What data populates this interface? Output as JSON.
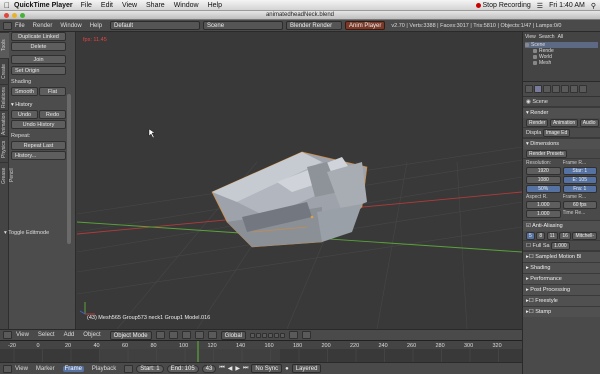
{
  "mac_menubar": {
    "app_name": "QuickTime Player",
    "menus": [
      "File",
      "Edit",
      "View",
      "Share",
      "Window",
      "Help"
    ],
    "recording_label": "Stop Recording",
    "clock": "Fri 1:40 AM"
  },
  "window": {
    "title": "animatedheadNeck.blend"
  },
  "info_header": {
    "menus": [
      "File",
      "Render",
      "Window",
      "Help"
    ],
    "screen_layout": "Default",
    "scene": "Scene",
    "render_engine": "Blender Render",
    "anim_player": "Anim Player",
    "stats": "v2.70 | Verts:3388 | Faces:3017 | Tris:5810 | Objects:1/47 | Lamps:0/0"
  },
  "tool_tabs": [
    "Tools",
    "Create",
    "Relations",
    "Animation",
    "Physics",
    "Grease Pencil"
  ],
  "tool_shelf": {
    "buttons_top": [
      "Duplicate Linked",
      "Delete",
      "Join",
      "Set Origin"
    ],
    "shading_label": "Shading",
    "shading_buttons": [
      "Smooth",
      "Flat"
    ],
    "history_label": "History",
    "history_row": [
      "Undo",
      "Redo"
    ],
    "undo_history": "Undo History",
    "repeat_label": "Repeat:",
    "repeat_last": "Repeat Last",
    "history_btn": "History...",
    "toggle_editmode": "Toggle Editmode"
  },
  "viewport": {
    "fps": "fps: 11.45",
    "object_info": "(43) Mesh565 Group573 neck1 Group1 Model.016"
  },
  "outliner": {
    "header": [
      "View",
      "Search",
      "All"
    ],
    "items": [
      "Scene",
      "Rende",
      "World",
      "Mesh"
    ]
  },
  "properties": {
    "breadcrumb": "Scene",
    "render_section": "Render",
    "render_buttons": [
      "Render",
      "Animation",
      "Audio"
    ],
    "display_label": "Displa",
    "display_value": "Image Ed",
    "dimensions_section": "Dimensions",
    "render_presets": "Render Presets",
    "resolution_label": "Resolution:",
    "frame_range_label": "Frame R...",
    "res_x": "1920",
    "res_y": "1080",
    "res_pct": "50%",
    "start": "Star: 1",
    "end": "E: 105",
    "frame_step": "Fra: 1",
    "aspect_label": "Aspect R.",
    "frame_rate_label": "Frame R...",
    "aspect_x": "1.000",
    "aspect_y": "1.000",
    "fps_value": "60 fps",
    "time_remap": "Time Re...",
    "antialiasing": "Anti-Aliasing",
    "aa_samples": [
      "5",
      "8",
      "11",
      "16"
    ],
    "aa_filter": "Mitchell-",
    "full_sample": "Full Sa",
    "aa_size": "1.000",
    "sections_collapsed": [
      "Sampled Motion Bl",
      "Shading",
      "Performance",
      "Post Processing",
      "Freestyle",
      "Stamp"
    ]
  },
  "view3d_header": {
    "menus": [
      "View",
      "Select",
      "Add",
      "Object"
    ],
    "mode": "Object Mode",
    "pivot": "Global"
  },
  "timeline": {
    "ticks": [
      "-20",
      "0",
      "20",
      "40",
      "60",
      "80",
      "100",
      "120",
      "140",
      "160",
      "180",
      "200",
      "220",
      "240",
      "260",
      "280",
      "300",
      "320"
    ],
    "header_menus": [
      "View",
      "Marker"
    ],
    "frame_menu": "Frame",
    "playback_menu": "Playback",
    "start_field": "Start:",
    "start_value": "1",
    "end_field": "End:",
    "end_value": "105",
    "current": "43",
    "sync": "No Sync",
    "keying": "Layered"
  },
  "colors": {
    "viewport_bg": "#393939",
    "x_axis": "#b33a3a",
    "y_axis": "#5aa33a",
    "selection_outline": "#e08a2a",
    "mesh": "#b7bcc4"
  }
}
